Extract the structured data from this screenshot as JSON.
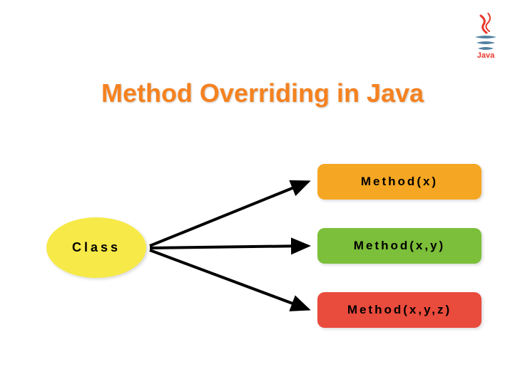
{
  "logo": {
    "label": "Java"
  },
  "title": "Method Overriding in Java",
  "class_node": {
    "label": "Class"
  },
  "methods": [
    {
      "label": "Method(x)",
      "color": "#f5a623"
    },
    {
      "label": "Method(x,y)",
      "color": "#7cbf3a"
    },
    {
      "label": "Method(x,y,z)",
      "color": "#e94b3c"
    }
  ]
}
